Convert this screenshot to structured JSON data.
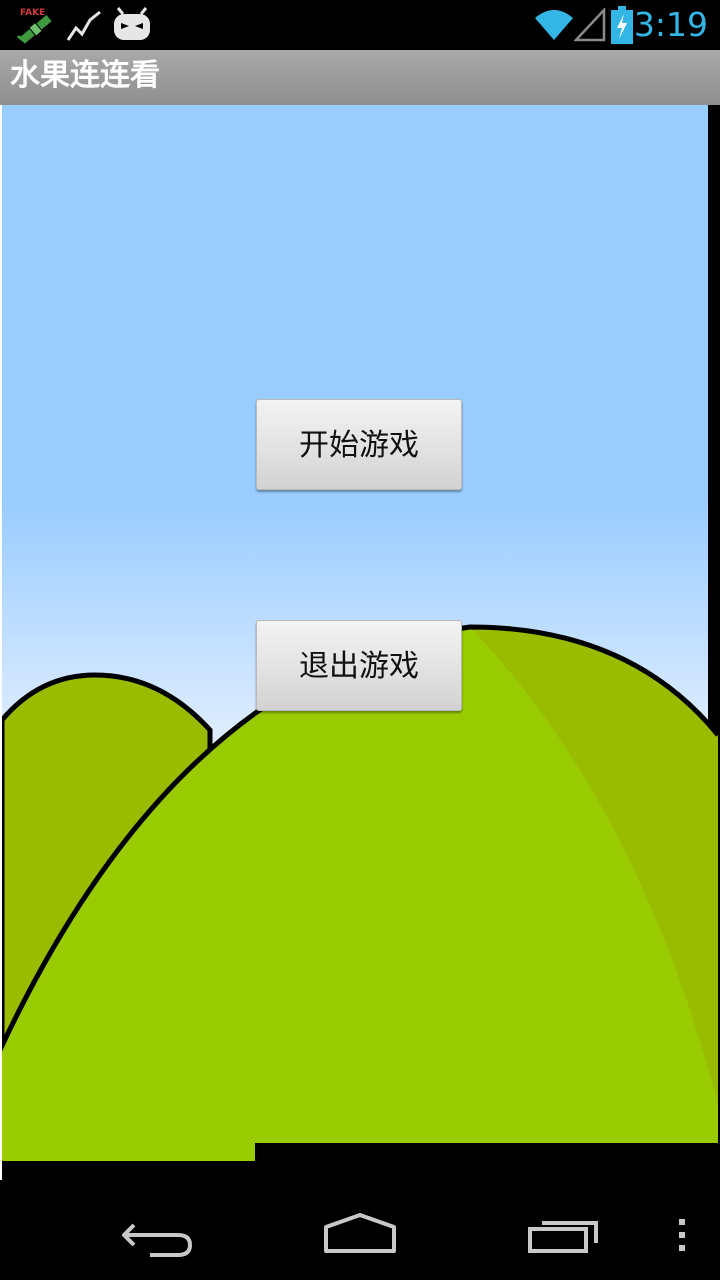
{
  "status_bar": {
    "time": "3:19",
    "icons": [
      "fake-gps-satellite-icon",
      "activity-graph-icon",
      "cyanogen-android-icon",
      "wifi-icon",
      "cell-signal-icon",
      "battery-charging-icon"
    ],
    "fake_badge_text": "FAKE",
    "accent_color": "#33b5e5"
  },
  "action_bar": {
    "title": "水果连连看"
  },
  "menu": {
    "start_label": "开始游戏",
    "exit_label": "退出游戏"
  },
  "scene": {
    "sky_color": "#99ccff",
    "hill_color": "#99cc00",
    "hill_shade_color": "#99bb00"
  },
  "nav_bar": {
    "icons": [
      "back-icon",
      "home-icon",
      "recent-apps-icon",
      "overflow-menu-icon"
    ]
  }
}
